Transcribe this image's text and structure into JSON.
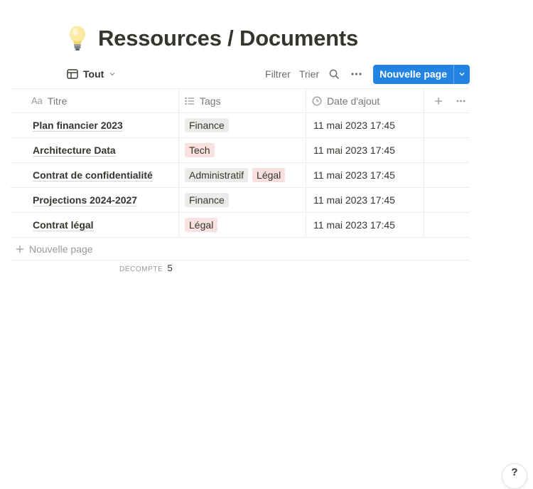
{
  "page": {
    "title": "Ressources / Documents",
    "icon": "lightbulb-icon"
  },
  "toolbar": {
    "view_label": "Tout",
    "filter_label": "Filtrer",
    "sort_label": "Trier",
    "new_page_label": "Nouvelle page",
    "accent_color": "#2383e2"
  },
  "table": {
    "columns": [
      {
        "label": "Titre",
        "icon": "text-aa-icon"
      },
      {
        "label": "Tags",
        "icon": "list-icon"
      },
      {
        "label": "Date d'ajout",
        "icon": "clock-icon"
      }
    ],
    "rows": [
      {
        "title": "Plan financier 2023",
        "tags": [
          "Finance"
        ],
        "date": "11 mai 2023 17:45"
      },
      {
        "title": "Architecture Data",
        "tags": [
          "Tech"
        ],
        "date": "11 mai 2023 17:45"
      },
      {
        "title": "Contrat de confidentialité",
        "tags": [
          "Administratif",
          "Légal"
        ],
        "date": "11 mai 2023 17:45"
      },
      {
        "title": "Projections 2024-2027",
        "tags": [
          "Finance"
        ],
        "date": "11 mai 2023 17:45"
      },
      {
        "title": "Contrat légal",
        "tags": [
          "Légal"
        ],
        "date": "11 mai 2023 17:45"
      }
    ],
    "add_row_label": "Nouvelle page"
  },
  "tag_colors": {
    "Finance": "#ebebea",
    "Administratif": "#ebebea",
    "Tech": "#f8e1de",
    "Légal": "#f8e1de"
  },
  "footer": {
    "count_label": "DÉCOMPTE",
    "count_value": "5"
  },
  "help": {
    "label": "?"
  }
}
